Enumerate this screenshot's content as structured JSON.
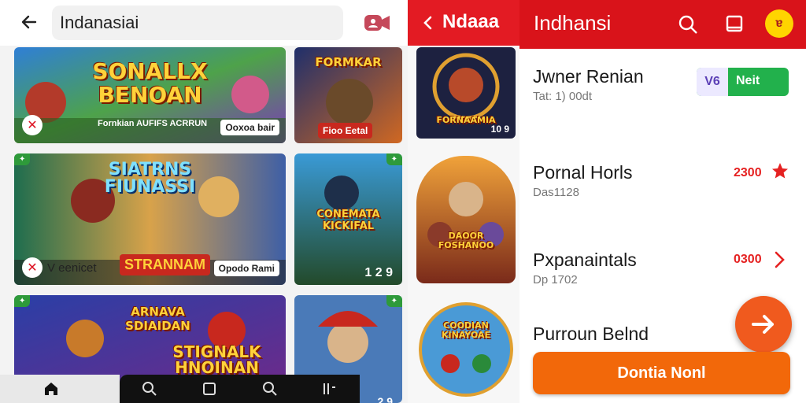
{
  "left": {
    "search_value": "Indanasiai",
    "cards": [
      {
        "title": "SONALLX\nBENOAN",
        "badge": "Ooxoa bair",
        "caption": "Fornkian AUFIFS ACRRUN",
        "tag": ""
      },
      {
        "title": "FORMKAR",
        "badge": "Fioo Eetal",
        "caption": "",
        "tag": ""
      },
      {
        "title": "SIATRNS\nFIUNASSI",
        "badge": "Opodo Rami",
        "caption": "V eenicet",
        "banner": "STRANNAM",
        "tag": ""
      },
      {
        "title": "CONEMATA\nKICKIFAL",
        "badge": "1 2 9",
        "caption": "",
        "tag": ""
      },
      {
        "title": "ARNAVA\nSDIAIDAN",
        "badge": "",
        "caption": "",
        "banner": "STIGNALK\nHNOINAN",
        "tag": ""
      },
      {
        "title": "",
        "badge": "2 9",
        "caption": "",
        "tag": ""
      }
    ]
  },
  "middle": {
    "title": "Ndaaa",
    "cards": [
      {
        "title": "FORNAAMIA",
        "badge": "10 9"
      },
      {
        "title": "DAOOR\nFOSHANOO",
        "badge": ""
      },
      {
        "title": "COODIAN\nKINAYOAE",
        "badge": ""
      }
    ]
  },
  "right": {
    "title": "Indhansi",
    "avatar_letter": "ɐ",
    "rows": [
      {
        "title": "Jwner Renian",
        "sub": "Tat: 1) 00dt"
      },
      {
        "title": "Pornal Horls",
        "sub": "Das1128",
        "value": "2300"
      },
      {
        "title": "Pxpanaintals",
        "sub": "Dp 1702",
        "value": "0300"
      },
      {
        "title": "Purroun Belnd",
        "sub": ""
      }
    ],
    "vip_badge": "V6",
    "vip_text": "Neit",
    "primary_button": "Dontia Nonl"
  },
  "colors": {
    "brand_red": "#e31b23",
    "accent_orange": "#f2680a",
    "vip_green": "#22b14c",
    "avatar_yellow": "#ffd400"
  },
  "icons": [
    "back-arrow-icon",
    "video-call-icon",
    "search-icon",
    "tablet-icon",
    "chevron-right-icon",
    "star-icon",
    "send-arrow-icon",
    "home-icon"
  ]
}
